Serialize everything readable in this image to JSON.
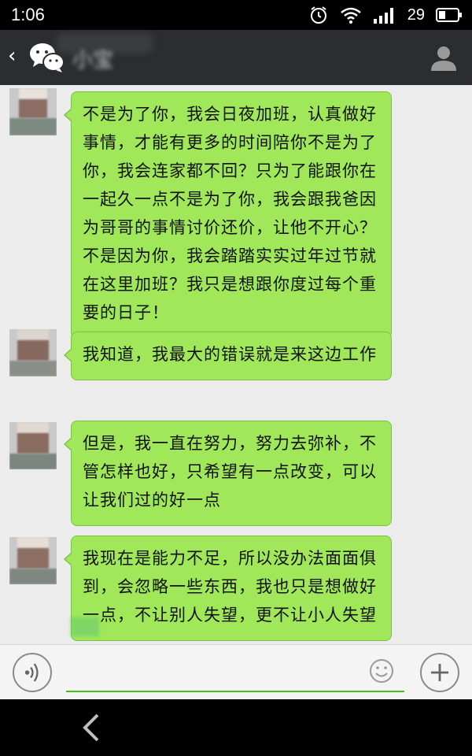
{
  "status_bar": {
    "time": "1:06",
    "battery_level": "29",
    "icons": [
      "alarm-icon",
      "wifi-icon",
      "signal-icon",
      "battery-icon"
    ]
  },
  "header": {
    "contact_name": "小宝",
    "icons": [
      "back-chevron-icon",
      "wechat-logo-icon",
      "profile-icon"
    ]
  },
  "messages": [
    {
      "text": "不是为了你，我会日夜加班，认真做好事情，才能有更多的时间陪你不是为了你，我会连家都不回？只为了能跟你在一起久一点不是为了你，我会跟我爸因为哥哥的事情讨价还价，让他不开心？不是因为你，我会踏踏实实过年过节就在这里加班？我只是想跟你度过每个重要的日子！"
    },
    {
      "text": "我知道，我最大的错误就是来这边工作"
    },
    {
      "text": "但是，我一直在努力，努力去弥补，不管怎样也好，只希望有一点改变，可以让我们过的好一点"
    },
    {
      "text": "我现在是能力不足，所以没办法面面俱到，会忽略一些东西，我也只是想做好一点，不让别人失望，更不让小人失望"
    }
  ],
  "input_bar": {
    "message_value": "",
    "icons": [
      "voice-icon",
      "emoji-icon",
      "plus-icon"
    ]
  },
  "nav_bar": {
    "icons": [
      "back-arrow-icon"
    ]
  },
  "colors": {
    "header_bg": "#2b2d31",
    "bubble_bg": "#a0e75a",
    "chat_bg": "#ececec",
    "input_underline": "#45c01a"
  }
}
